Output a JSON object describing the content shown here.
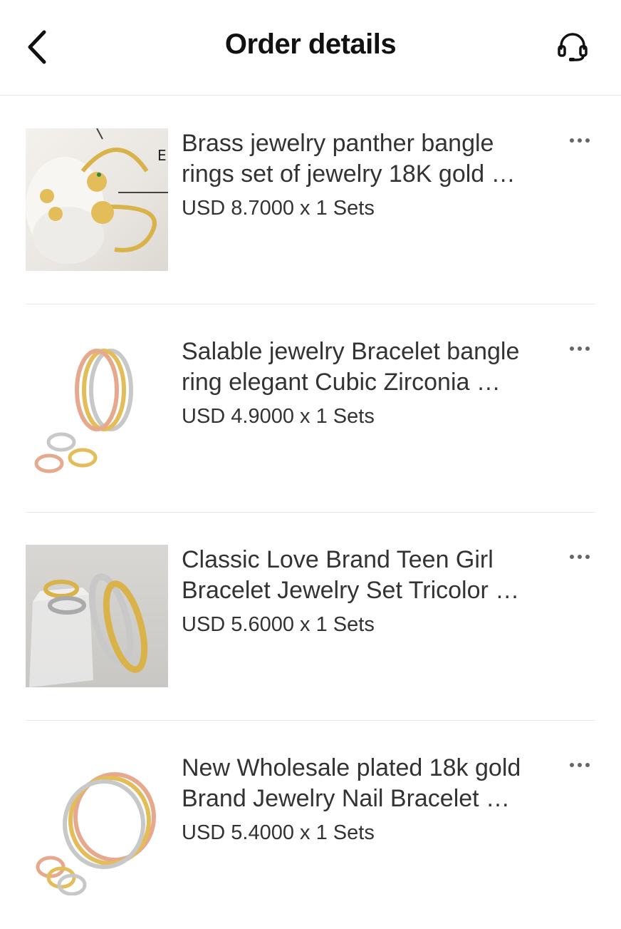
{
  "header": {
    "title": "Order details",
    "back_icon": "chevron-left-icon",
    "support_icon": "headset-icon"
  },
  "items": [
    {
      "name": "Brass jewelry panther bangle rings set of jewelry 18K gold …",
      "price": "USD 8.7000 x 1 Sets",
      "image": "panther-bangle-set-image"
    },
    {
      "name": "Salable jewelry Bracelet bangle ring elegant Cubic Zirconia …",
      "price": "USD 4.9000 x 1 Sets",
      "image": "nail-bangle-tricolor-image"
    },
    {
      "name": "Classic Love Brand Teen Girl Bracelet Jewelry Set Tricolor …",
      "price": "USD 5.6000 x 1 Sets",
      "image": "love-bracelet-set-image"
    },
    {
      "name": "New Wholesale plated 18k gold Brand Jewelry Nail Bracelet …",
      "price": "USD 5.4000 x 1 Sets",
      "image": "nail-bracelet-gold-image"
    }
  ],
  "colors": {
    "gold": "#d9b24a",
    "rose_gold": "#e7a98e",
    "silver": "#c8c8c8",
    "text": "#333333"
  }
}
